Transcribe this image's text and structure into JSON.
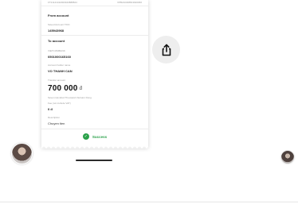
{
  "receipt": {
    "transaction_ref": "FT21121342000943888824",
    "transaction_code": "VPB210308813920066",
    "from_section": "From account",
    "source_label": "Saved Account TKKI",
    "source_value": "145943968",
    "to_section": "To account",
    "dest_account_label": "VIETCOMBANK",
    "dest_account_value": "0501000165160",
    "holder_label": "Account holder name",
    "holder_value": "VO THANH CAN",
    "amount_label": "Transfer amount",
    "amount_value": "700 000",
    "currency": "đ",
    "amount_words": "Seven Hundred Thousand Vietnam Dong",
    "fee_label": "Fee (not include VAT)",
    "fee_value": "0 đ",
    "desc_label": "Description",
    "desc_value": "Chuyen tien",
    "status": "Success"
  },
  "icons": {
    "share": "share-icon",
    "success": "check-circle-icon"
  },
  "colors": {
    "success": "#2aa14a",
    "share_bg": "#eeeeee",
    "text_dark": "#222222",
    "text_muted": "#9a9a9a"
  }
}
